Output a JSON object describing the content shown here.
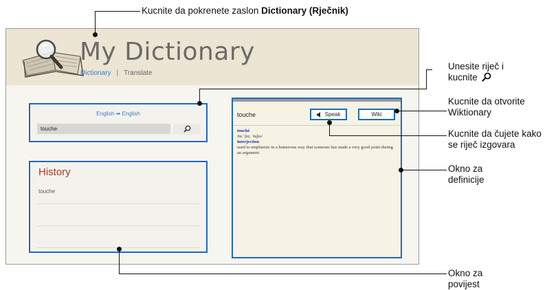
{
  "annotations": {
    "top_prefix": "Kucnite da pokrenete zaslon ",
    "top_bold": "Dictionary (Rječnik)",
    "search_line1": "Unesite riječ i",
    "search_line2": "kucnite",
    "wiki_line1": "Kucnite da otvorite",
    "wiki_line2": "Wiktionary",
    "speak_line1": "Kucnite da čujete kako",
    "speak_line2": "se riječ izgovara",
    "definition_line1": "Okno za",
    "definition_line2": "definicije",
    "history_line1": "Okno za",
    "history_line2": "povijest"
  },
  "app": {
    "title": "My Dictionary",
    "tabs": [
      "Dictionary",
      "Translate"
    ],
    "separator": "|"
  },
  "search": {
    "source_lang": "English",
    "target_lang": "English",
    "arrow": "➡",
    "value": "touche"
  },
  "history": {
    "title": "History",
    "items": [
      "touche"
    ]
  },
  "definition": {
    "word": "touche",
    "speak_label": "Speak",
    "wiki_label": "Wiki",
    "headword": "touché",
    "pronunciation": "/tuːˈʃeɪ; ˈtuʃeɪ/",
    "part_of_speech": "interjection",
    "meaning": "used to emphasize in a humorous way that someone has made a very good point during an argument"
  },
  "colors": {
    "highlight_border": "#1f67c4",
    "accent_blue": "#3a7fd0",
    "history_title": "#a23b2a",
    "header_bg": "#ece5d3"
  },
  "icons": [
    "book-magnifier-logo-icon",
    "search-icon",
    "speaker-icon",
    "arrow-right-icon"
  ]
}
